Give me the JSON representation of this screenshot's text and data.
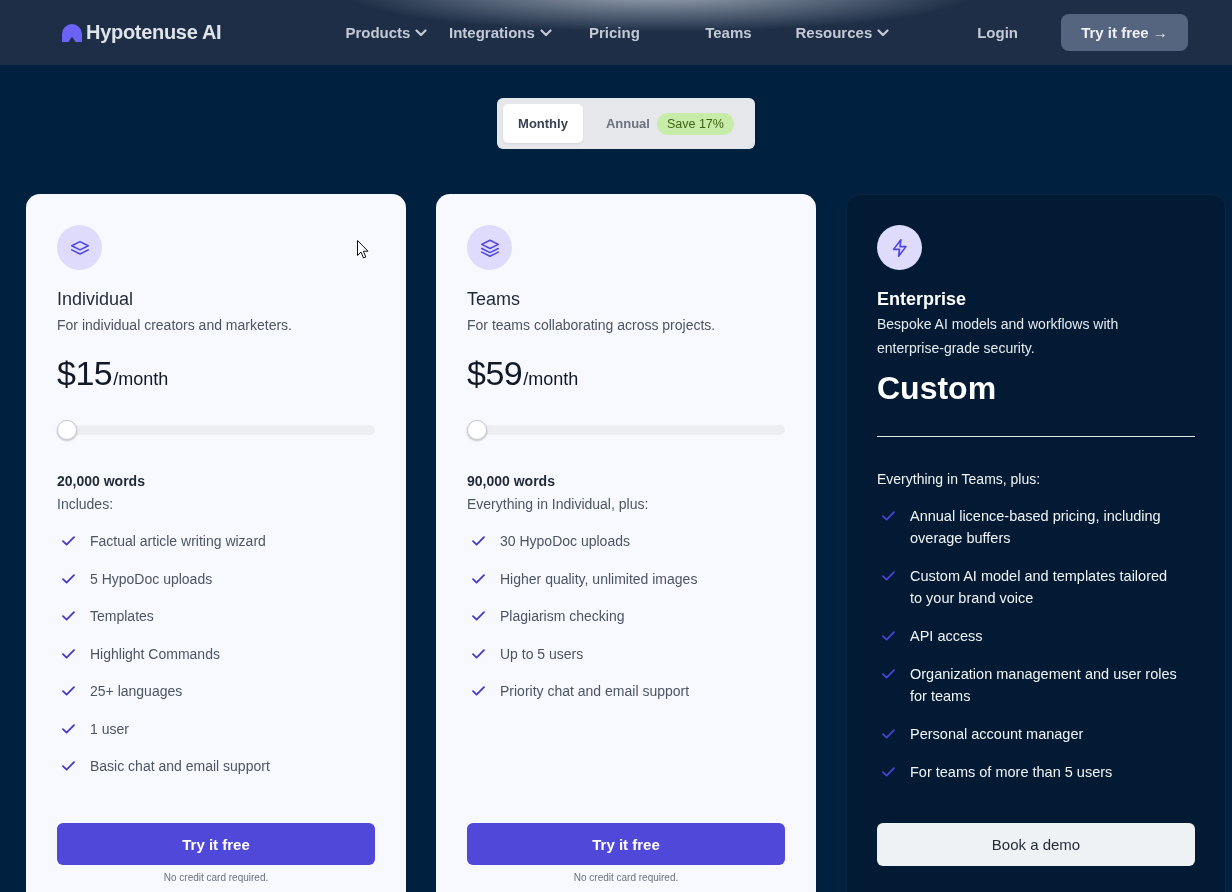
{
  "nav": {
    "brand": "Hypotenuse AI",
    "items": [
      {
        "label": "Products",
        "has_menu": true
      },
      {
        "label": "Integrations",
        "has_menu": true
      },
      {
        "label": "Pricing",
        "has_menu": false
      },
      {
        "label": "Teams",
        "has_menu": false
      },
      {
        "label": "Resources",
        "has_menu": true
      }
    ],
    "login": "Login",
    "cta": "Try it free →"
  },
  "billing_toggle": {
    "options": [
      {
        "label": "Monthly",
        "selected": true
      },
      {
        "label": "Annual",
        "selected": false,
        "badge": "Save 17%"
      }
    ]
  },
  "plans": [
    {
      "kind": "light",
      "name": "Individual",
      "description": "For individual creators and marketers.",
      "price": "$15",
      "period": "/month",
      "slider": {
        "level": 0
      },
      "words": "20,000 words",
      "includes_label": "Includes:",
      "features": [
        "Factual article writing wizard",
        "5 HypoDoc uploads",
        "Templates",
        "Highlight Commands",
        "25+ languages",
        "1 user",
        "Basic chat and email support"
      ],
      "button": "Try it free",
      "note": "No credit card required."
    },
    {
      "kind": "light",
      "name": "Teams",
      "description": "For teams collaborating across projects.",
      "price": "$59",
      "period": "/month",
      "slider": {
        "level": 0
      },
      "words": "90,000 words",
      "includes_label": "Everything in Individual, plus:",
      "features": [
        "30 HypoDoc uploads",
        "Higher quality, unlimited images",
        "Plagiarism checking",
        "Up to 5 users",
        "Priority chat and email support"
      ],
      "button": "Try it free",
      "note": "No credit card required."
    },
    {
      "kind": "dark",
      "name": "Enterprise",
      "description": "Bespoke AI models and workflows with enterprise-grade security.",
      "price": "Custom",
      "includes_label": "Everything in Teams, plus:",
      "features": [
        "Annual licence-based pricing, including overage buffers",
        "Custom AI model and templates tailored to your brand voice",
        "API access",
        "Organization management and user roles for teams",
        "Personal account manager",
        "For teams of more than 5 users"
      ],
      "button": "Book a demo"
    }
  ]
}
